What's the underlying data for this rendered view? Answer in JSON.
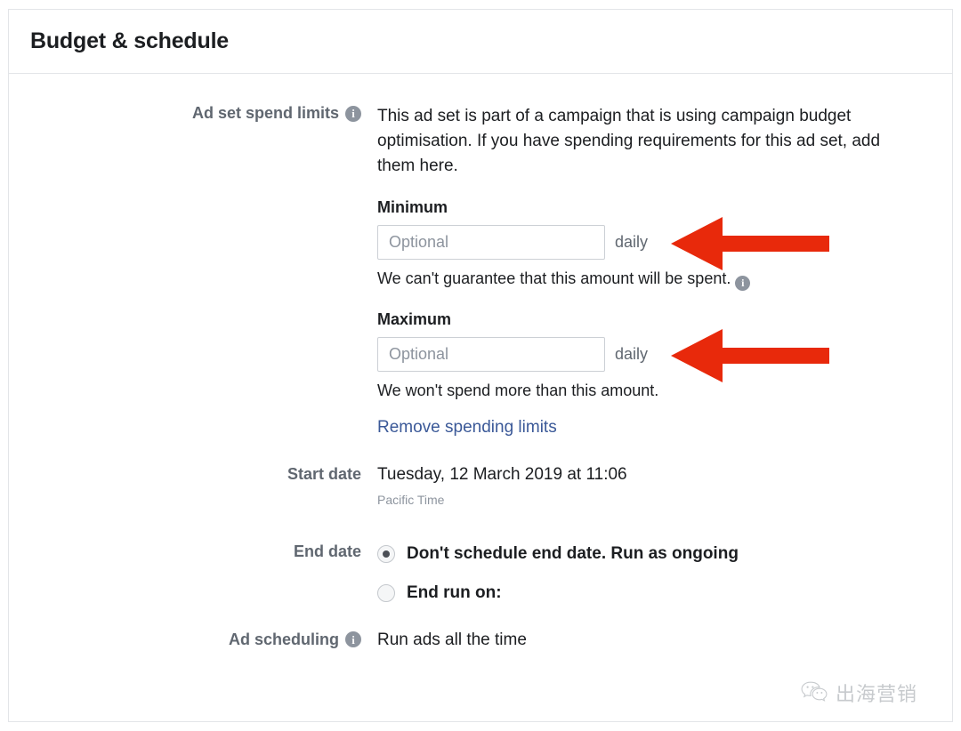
{
  "card": {
    "title": "Budget & schedule"
  },
  "spend_limits": {
    "label": "Ad set spend limits",
    "info_icon": "info-icon",
    "description": "This ad set is part of a campaign that is using campaign budget optimisation. If you have spending requirements for this ad set, add them here.",
    "minimum": {
      "label": "Minimum",
      "placeholder": "Optional",
      "value": "",
      "unit": "daily",
      "help": "We can't guarantee that this amount will be spent.",
      "help_info_icon": "info-icon"
    },
    "maximum": {
      "label": "Maximum",
      "placeholder": "Optional",
      "value": "",
      "unit": "daily",
      "help": "We won't spend more than this amount."
    },
    "remove_link": "Remove spending limits"
  },
  "start_date": {
    "label": "Start date",
    "value": "Tuesday, 12 March 2019 at 11:06",
    "timezone": "Pacific Time"
  },
  "end_date": {
    "label": "End date",
    "options": [
      {
        "label": "Don't schedule end date. Run as ongoing",
        "selected": true
      },
      {
        "label": "End run on:",
        "selected": false
      }
    ]
  },
  "ad_scheduling": {
    "label": "Ad scheduling",
    "info_icon": "info-icon",
    "value": "Run ads all the time"
  },
  "annotations": {
    "arrow_color": "#e8290b",
    "arrows": [
      {
        "name": "arrow-pointing-to-minimum-field",
        "direction": "left"
      },
      {
        "name": "arrow-pointing-to-maximum-field",
        "direction": "left"
      }
    ]
  },
  "watermark": {
    "icon": "wechat-icon",
    "text": "出海营销"
  },
  "colors": {
    "link": "#3b5998",
    "label": "#606770",
    "text": "#1c1e21",
    "border": "#e3e5e8",
    "input_border": "#ccd0d5",
    "placeholder": "#8d949e",
    "accent_red": "#e8290b"
  }
}
